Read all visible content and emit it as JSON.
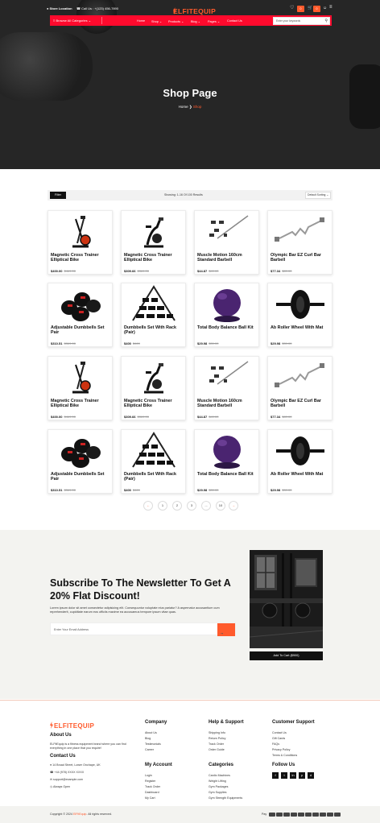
{
  "topbar": {
    "store_locator": "Store Location",
    "call_us": "Call Us : +(123) 456-7890",
    "logo": "ELFITEQUIP",
    "cart_count": "0"
  },
  "nav": {
    "browse": "Browse All Categories",
    "items": [
      "Home",
      "Shop",
      "Products",
      "Blog",
      "Pages",
      "Contact Us"
    ],
    "search_placeholder": "Enter your keywords"
  },
  "hero": {
    "title": "Shop Page",
    "crumb_home": "Home",
    "crumb_current": "Shop"
  },
  "toolbar": {
    "filter": "Filter",
    "showing": "Showing: 1-16 Of 100 Results",
    "sort": "Default Sorting"
  },
  "products": [
    {
      "name": "Magnetic Cross Trainer Elliptical Bike",
      "price": "$400.00",
      "old": "$469.00",
      "icon": "cross-trainer"
    },
    {
      "name": "Magnetic Cross Trainer Elliptical Bike",
      "price": "$309.66",
      "old": "$369.00",
      "icon": "exercise-bike"
    },
    {
      "name": "Muscle Motion 160cm Standard Barbell",
      "price": "$44.87",
      "old": "$49.00",
      "icon": "barbell"
    },
    {
      "name": "Olympic Bar EZ Curl Bar Barbell",
      "price": "$77.34",
      "old": "$89.00",
      "icon": "curl-bar"
    },
    {
      "name": "Adjustable Dumbbells Set Pair",
      "price": "$310.51",
      "old": "$369.00",
      "icon": "dumbbells"
    },
    {
      "name": "Dumbbells Set With Rack (Pair)",
      "price": "$400",
      "old": "$469",
      "icon": "dumbbell-rack"
    },
    {
      "name": "Total Body Balance Ball Kit",
      "price": "$29.98",
      "old": "$39.00",
      "icon": "balance-ball"
    },
    {
      "name": "Ab Roller Wheel With Mat",
      "price": "$29.98",
      "old": "$39.00",
      "icon": "ab-roller"
    },
    {
      "name": "Magnetic Cross Trainer Elliptical Bike",
      "price": "$400.00",
      "old": "$469.00",
      "icon": "cross-trainer"
    },
    {
      "name": "Magnetic Cross Trainer Elliptical Bike",
      "price": "$309.66",
      "old": "$369.00",
      "icon": "exercise-bike"
    },
    {
      "name": "Muscle Motion 160cm Standard Barbell",
      "price": "$44.87",
      "old": "$49.00",
      "icon": "barbell"
    },
    {
      "name": "Olympic Bar EZ Curl Bar Barbell",
      "price": "$77.34",
      "old": "$89.00",
      "icon": "curl-bar"
    },
    {
      "name": "Adjustable Dumbbells Set Pair",
      "price": "$310.51",
      "old": "$369.00",
      "icon": "dumbbells"
    },
    {
      "name": "Dumbbells Set With Rack (Pair)",
      "price": "$400",
      "old": "$469",
      "icon": "dumbbell-rack"
    },
    {
      "name": "Total Body Balance Ball Kit",
      "price": "$29.98",
      "old": "$39.00",
      "icon": "balance-ball"
    },
    {
      "name": "Ab Roller Wheel With Mat",
      "price": "$29.98",
      "old": "$39.00",
      "icon": "ab-roller"
    }
  ],
  "pagination": [
    "1",
    "2",
    "3",
    "...",
    "10"
  ],
  "newsletter": {
    "title": "Subscribe To The Newsletter To Get A 20% Flat Discount!",
    "desc": "Lorem ipsum dolor sit amet consectetur adipisicing elit. Consequuntur voluptate eius pariatur? A aspernatur accusantium cum reprehenderit, cupiditate earum eos officiis maxime ea accusamus tempore ipsum vitae quas.",
    "placeholder": "Enter Your Email Address",
    "cta": "Add To Cart ($900)"
  },
  "footer": {
    "logo": "ELFITEQUIP",
    "about_title": "About Us",
    "about_text": "ELFitEquip is a fitness equipment brand where you can find everything in one place that you require!",
    "contact_title": "Contact Us",
    "contacts": [
      "14 Broad Street, Lower Onchape, UK",
      "+44 (978) XXXX XXXX",
      "support@example.com",
      "Always Open"
    ],
    "company_title": "Company",
    "company": [
      "About Us",
      "Blog",
      "Testimonials",
      "Career"
    ],
    "account_title": "My Account",
    "account": [
      "Login",
      "Register",
      "Track Order",
      "Dashboard",
      "My Cart"
    ],
    "help_title": "Help & Support",
    "help": [
      "Shipping Info",
      "Return Policy",
      "Track Order",
      "Order Guide"
    ],
    "cat_title": "Categories",
    "cats": [
      "Cardio Machines",
      "Weight Lifting",
      "Gym Packages",
      "Gym Supplies",
      "Gym Strength Equipments"
    ],
    "cs_title": "Customer Support",
    "cs": [
      "Contact Us",
      "Gift Cards",
      "FAQs",
      "Privacy Policy",
      "Terms & Conditions"
    ],
    "follow_title": "Follow Us",
    "social": [
      "f",
      "t",
      "in",
      "p",
      "d"
    ],
    "copyright_prefix": "Copyright © 2024",
    "copyright_brand": "ElFitEquip",
    "copyright_suffix": ". All rights reserved.",
    "pay_label": "Pay"
  },
  "colors": {
    "accent": "#ff5a2c",
    "nav_red": "#ff0a2d"
  }
}
